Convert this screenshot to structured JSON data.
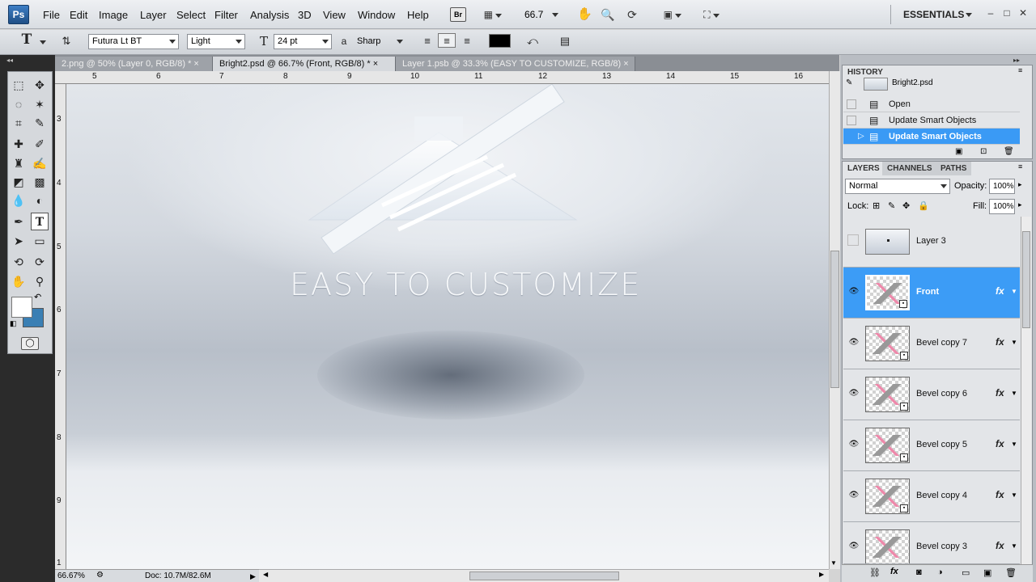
{
  "app": {
    "logo": "Ps",
    "workspace": "ESSENTIALS",
    "zoom_display": "66.7",
    "bridge_badge": "Br"
  },
  "menu": {
    "items": [
      "File",
      "Edit",
      "Image",
      "Layer",
      "Select",
      "Filter",
      "Analysis",
      "3D",
      "View",
      "Window",
      "Help"
    ]
  },
  "options": {
    "tool_glyph": "T",
    "font_family": "Futura Lt BT",
    "font_style": "Light",
    "font_size": "24 pt",
    "aa_label": "a",
    "antialias": "Sharp",
    "text_color": "#000000"
  },
  "tabs": [
    {
      "label": "2.png @ 50% (Layer 0, RGB/8) *",
      "active": false
    },
    {
      "label": "Bright2.psd @ 66.7% (Front, RGB/8) *",
      "active": true
    },
    {
      "label": "Layer 1.psb @ 33.3% (EASY TO CUSTOMIZE, RGB/8)",
      "active": false
    }
  ],
  "ruler": {
    "h_numbers": [
      "5",
      "6",
      "7",
      "8",
      "9",
      "10",
      "11",
      "12",
      "13",
      "14",
      "15",
      "16"
    ],
    "v_numbers": [
      "3",
      "4",
      "5",
      "6",
      "7",
      "8",
      "9",
      "1"
    ]
  },
  "canvas": {
    "headline": "EASY TO CUSTOMIZE"
  },
  "status": {
    "zoom": "66.67%",
    "doc": "Doc: 10.7M/82.6M"
  },
  "history": {
    "tab": "HISTORY",
    "snapshot": "Bright2.psd",
    "items": [
      {
        "label": "Open",
        "selected": false
      },
      {
        "label": "Update Smart Objects",
        "selected": false
      },
      {
        "label": "Update Smart Objects",
        "selected": true
      }
    ]
  },
  "layers_panel": {
    "tabs": [
      "LAYERS",
      "CHANNELS",
      "PATHS"
    ],
    "blend_mode": "Normal",
    "opacity_label": "Opacity:",
    "opacity": "100%",
    "lock_label": "Lock:",
    "fill_label": "Fill:",
    "fill": "100%",
    "layers": [
      {
        "name": "Layer 3",
        "visible": false,
        "selected": false,
        "fx": false
      },
      {
        "name": "Front",
        "visible": true,
        "selected": true,
        "fx": true
      },
      {
        "name": "Bevel copy 7",
        "visible": true,
        "selected": false,
        "fx": true
      },
      {
        "name": "Bevel copy 6",
        "visible": true,
        "selected": false,
        "fx": true
      },
      {
        "name": "Bevel copy 5",
        "visible": true,
        "selected": false,
        "fx": true
      },
      {
        "name": "Bevel copy 4",
        "visible": true,
        "selected": false,
        "fx": true
      },
      {
        "name": "Bevel copy 3",
        "visible": true,
        "selected": false,
        "fx": true
      }
    ],
    "fx_label": "fx"
  },
  "colors": {
    "selection": "#3a9af5",
    "foreground": "#ffffff",
    "background": "#3a7fb4"
  }
}
